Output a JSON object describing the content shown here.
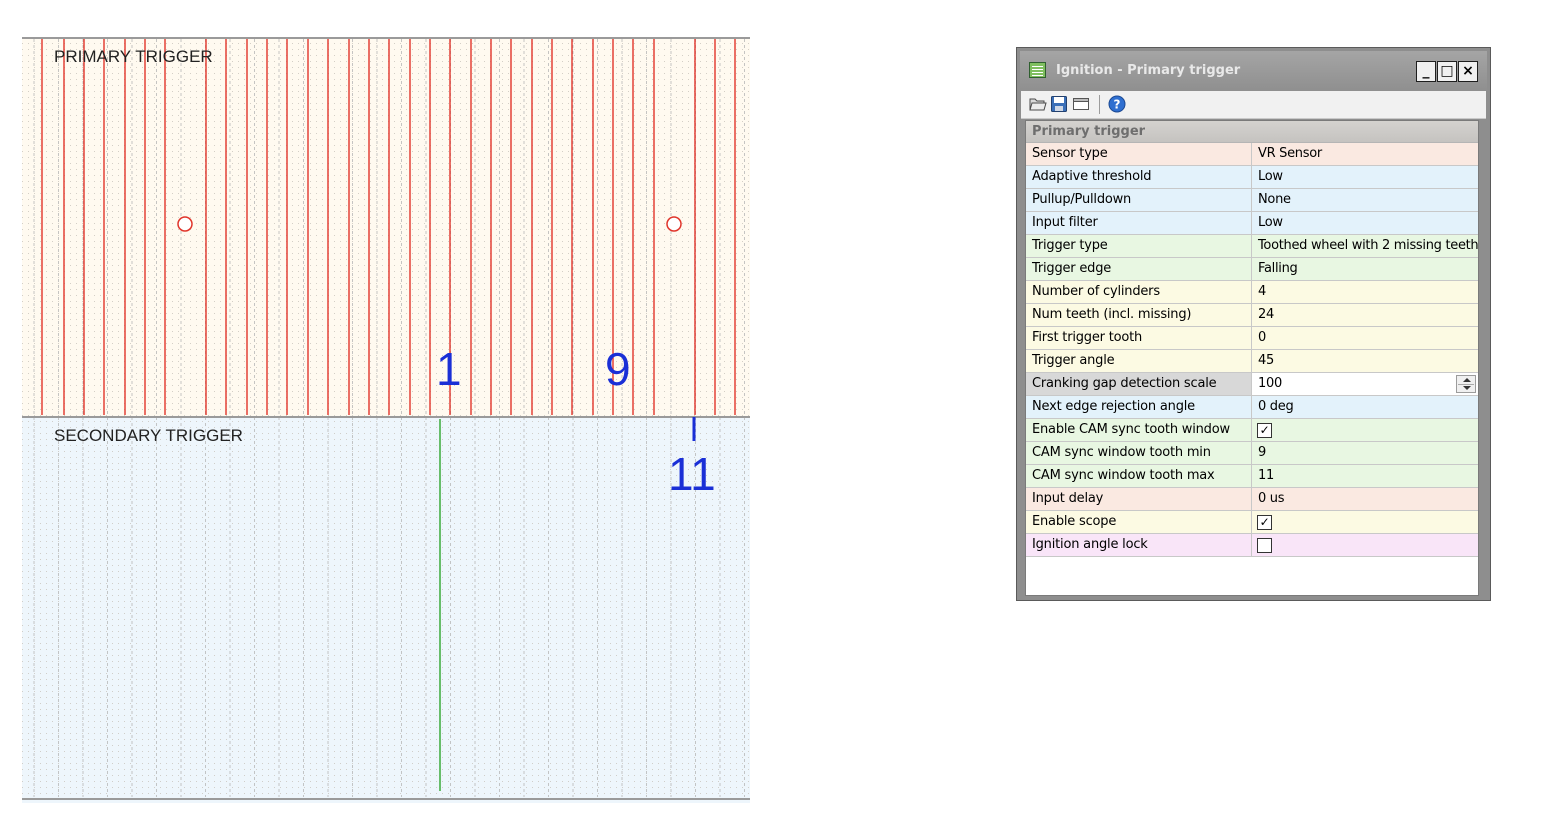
{
  "scope": {
    "primary_label": "PRIMARY TRIGGER",
    "secondary_label": "SECONDARY TRIGGER",
    "tooth_labels": {
      "first": "1",
      "sync_min": "9",
      "sync_max": "11"
    },
    "colors": {
      "primary_bg": "#fffaf0",
      "secondary_bg": "#eef6fc",
      "tooth_line": "#e0342a",
      "green_marker": "#3aaa3a",
      "tooth_label": "#1a2fd6"
    }
  },
  "dialog": {
    "title": "Ignition - Primary trigger",
    "window_buttons": {
      "minimize": "_",
      "maximize": "□",
      "close": "×"
    },
    "toolbar_icons": [
      "folder-open-icon",
      "save-icon",
      "window-icon",
      "help-icon"
    ],
    "help_glyph": "?",
    "section": "Primary trigger",
    "rows": [
      {
        "name": "Sensor type",
        "value": "VR Sensor",
        "color": "salmon"
      },
      {
        "name": "Adaptive threshold",
        "value": "Low",
        "color": "blue"
      },
      {
        "name": "Pullup/Pulldown",
        "value": "None",
        "color": "blue"
      },
      {
        "name": "Input filter",
        "value": "Low",
        "color": "blue"
      },
      {
        "name": "Trigger type",
        "value": "Toothed wheel with 2 missing teeth",
        "color": "green"
      },
      {
        "name": "Trigger edge",
        "value": "Falling",
        "color": "green"
      },
      {
        "name": "Number of cylinders",
        "value": "4",
        "color": "yellow"
      },
      {
        "name": "Num teeth (incl. missing)",
        "value": "24",
        "color": "yellow"
      },
      {
        "name": "First trigger tooth",
        "value": "0",
        "color": "yellow"
      },
      {
        "name": "Trigger angle",
        "value": "45",
        "color": "yellow"
      },
      {
        "name": "Cranking gap detection scale",
        "value": "100",
        "color": "gray"
      },
      {
        "name": "Next edge rejection angle",
        "value": "0 deg",
        "color": "blue"
      },
      {
        "name": "Enable CAM sync tooth window",
        "value": "",
        "checked": true,
        "color": "green"
      },
      {
        "name": "CAM sync window tooth min",
        "value": "9",
        "color": "green"
      },
      {
        "name": "CAM sync window tooth max",
        "value": "11",
        "color": "green"
      },
      {
        "name": "Input delay",
        "value": "0 us",
        "color": "salmon"
      },
      {
        "name": "Enable scope",
        "value": "",
        "checked": true,
        "color": "yellow"
      },
      {
        "name": "Ignition angle lock",
        "value": "",
        "checked": false,
        "color": "pink"
      }
    ],
    "check_glyph": "✓"
  }
}
